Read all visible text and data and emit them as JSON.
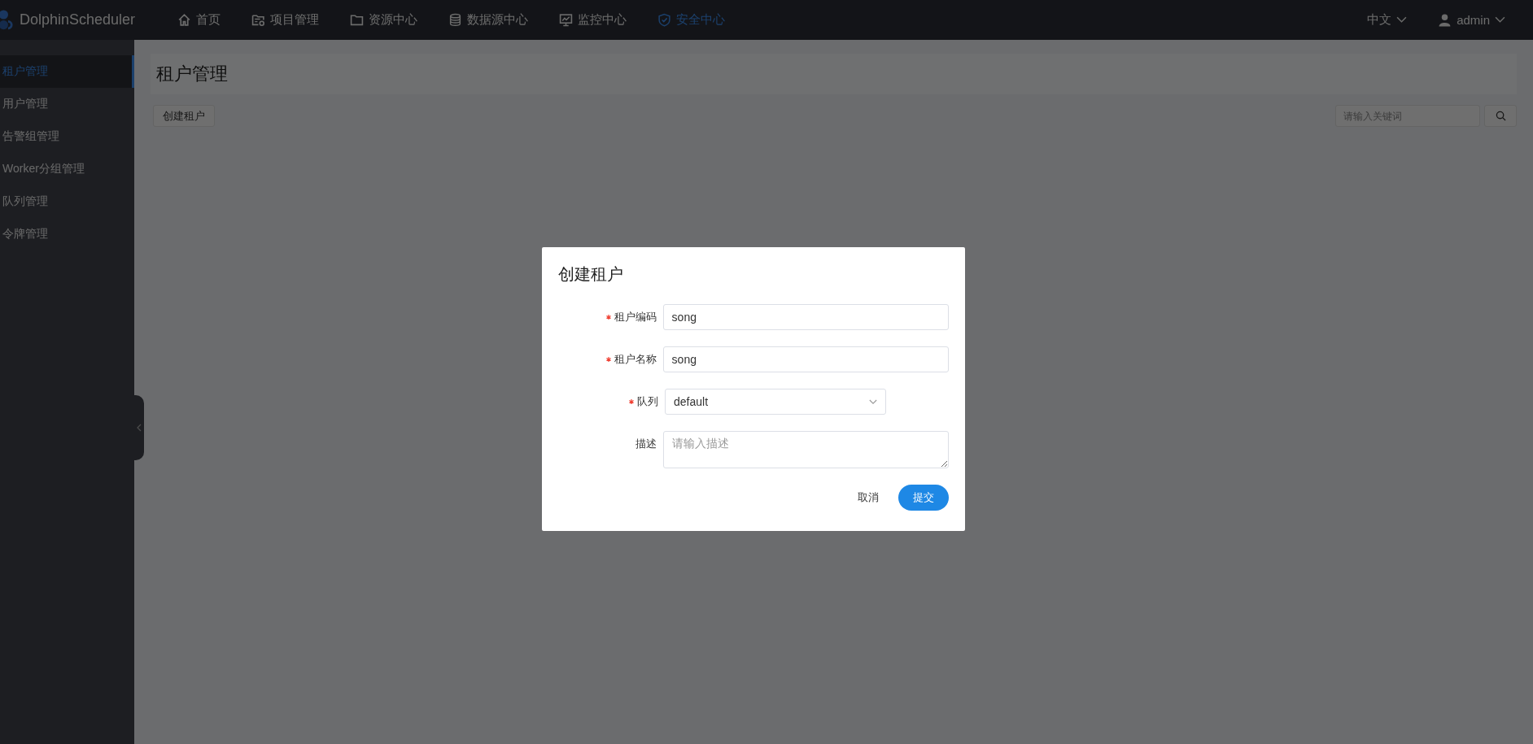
{
  "app": {
    "logo": "DolphinScheduler"
  },
  "nav": [
    {
      "label": "首页",
      "kind": "home",
      "selected": false
    },
    {
      "label": "项目管理",
      "kind": "project",
      "selected": false
    },
    {
      "label": "资源中心",
      "kind": "folder",
      "selected": false
    },
    {
      "label": "数据源中心",
      "kind": "database",
      "selected": false
    },
    {
      "label": "监控中心",
      "kind": "monitor",
      "selected": false
    },
    {
      "label": "安全中心",
      "kind": "shield",
      "selected": true
    }
  ],
  "language": "中文",
  "user": "admin",
  "sidebar": {
    "items": [
      {
        "label": "租户管理",
        "selected": true
      },
      {
        "label": "用户管理",
        "selected": false
      },
      {
        "label": "告警组管理",
        "selected": false
      },
      {
        "label": "Worker分组管理",
        "selected": false
      },
      {
        "label": "队列管理",
        "selected": false
      },
      {
        "label": "令牌管理",
        "selected": false
      }
    ]
  },
  "page": {
    "title": "租户管理",
    "create_button": "创建租户",
    "search": {
      "placeholder": "请输入关键词"
    }
  },
  "dialog": {
    "title": "创建租户",
    "fields": [
      {
        "kind": "input",
        "label": "租户编码",
        "required": true,
        "value": "song"
      },
      {
        "kind": "input",
        "label": "租户名称",
        "required": true,
        "value": "song"
      },
      {
        "kind": "select",
        "label": "队列",
        "required": true,
        "value": "default"
      },
      {
        "kind": "textarea",
        "label": "描述",
        "required": false,
        "placeholder": "请输入描述"
      }
    ],
    "buttons": [
      {
        "label": "取消",
        "kind": "text"
      },
      {
        "label": "提交",
        "kind": "primary"
      }
    ]
  }
}
